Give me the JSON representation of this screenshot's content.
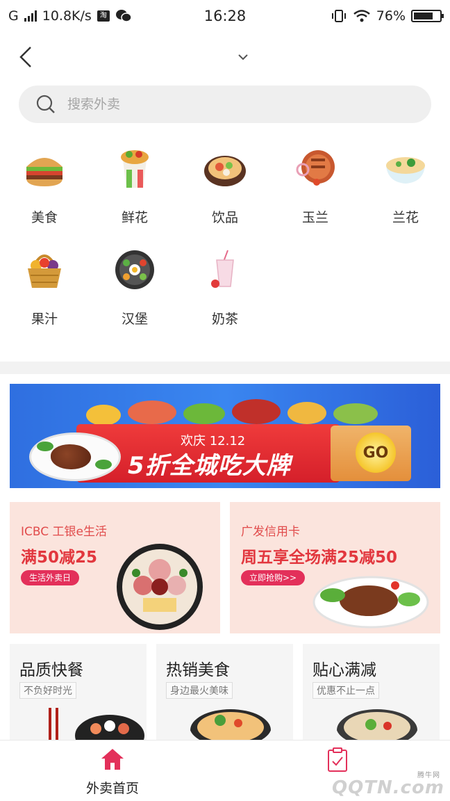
{
  "status": {
    "carrier": "G",
    "net_speed": "10.8K/s",
    "app_badge": "淘",
    "time": "16:28",
    "battery": "76%",
    "battery_level": 0.76
  },
  "search": {
    "placeholder": "搜索外卖"
  },
  "categories": [
    {
      "label": "美食",
      "icon": "burger-icon"
    },
    {
      "label": "鲜花",
      "icon": "wrap-icon"
    },
    {
      "label": "饮品",
      "icon": "hotpot-icon"
    },
    {
      "label": "玉兰",
      "icon": "pizza-icon"
    },
    {
      "label": "兰花",
      "icon": "noodle-bowl-icon"
    },
    {
      "label": "果汁",
      "icon": "fruit-basket-icon"
    },
    {
      "label": "汉堡",
      "icon": "bibimbap-icon"
    },
    {
      "label": "奶茶",
      "icon": "milkshake-icon"
    }
  ],
  "banner": {
    "subtitle": "欢庆 12.12",
    "title": "5折全城吃大牌",
    "go_label": "GO"
  },
  "promos": [
    {
      "bank": "ICBC 工银e生活",
      "offer": "满50减25",
      "tag": "生活外卖日"
    },
    {
      "bank": "广发信用卡",
      "offer": "周五享全场满25减50",
      "tag": "立即抢购>>"
    }
  ],
  "features": [
    {
      "title": "品质快餐",
      "subtitle": "不负好时光"
    },
    {
      "title": "热销美食",
      "subtitle": "身边最火美味"
    },
    {
      "title": "贴心满减",
      "subtitle": "优惠不止一点"
    }
  ],
  "tabs": [
    {
      "label": "外卖首页",
      "icon": "home-icon",
      "active": true
    },
    {
      "label": "",
      "icon": "orders-icon",
      "active": false
    }
  ],
  "watermark": {
    "text": "QQTN.com",
    "small": "腾牛网"
  },
  "colors": {
    "accent": "#e3305a",
    "promo_bg": "#fbe4dd",
    "search_bg": "#efefef"
  }
}
